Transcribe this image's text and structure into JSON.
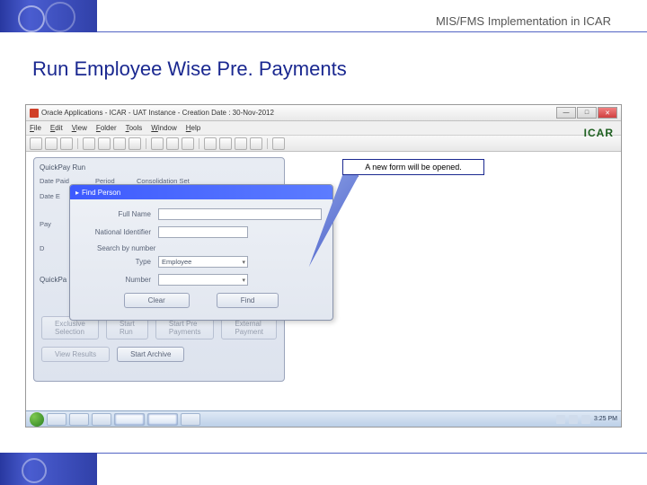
{
  "header": {
    "title": "MIS/FMS Implementation in ICAR"
  },
  "slide": {
    "title": "Run Employee Wise Pre. Payments"
  },
  "window": {
    "title": "Oracle Applications - ICAR - UAT Instance - Creation Date : 30-Nov-2012",
    "menus": [
      "File",
      "Edit",
      "View",
      "Folder",
      "Tools",
      "Window",
      "Help"
    ],
    "logo": "ICAR"
  },
  "quickpay": {
    "heading": "QuickPay Run",
    "labels": {
      "date_paid": "Date Paid",
      "period": "Period",
      "cons_set": "Consolidation Set",
      "date_earned": "Date E",
      "pay": "Pay",
      "d": "D"
    },
    "section2": "QuickPa",
    "buttons": {
      "exclusive": "Exclusive Selection",
      "start_run": "Start Run",
      "start_pre": "Start Pre Payments",
      "external": "External Payment",
      "view_results": "View Results",
      "start_archive": "Start Archive"
    }
  },
  "find": {
    "title": "Find Person",
    "labels": {
      "full_name": "Full Name",
      "national_id": "National Identifier",
      "search_by": "Search by number",
      "type": "Type",
      "number": "Number"
    },
    "type_value": "Employee",
    "buttons": {
      "clear": "Clear",
      "find": "Find"
    }
  },
  "callout": {
    "text": "A new form will be opened."
  },
  "taskbar": {
    "time": "3:25 PM"
  }
}
